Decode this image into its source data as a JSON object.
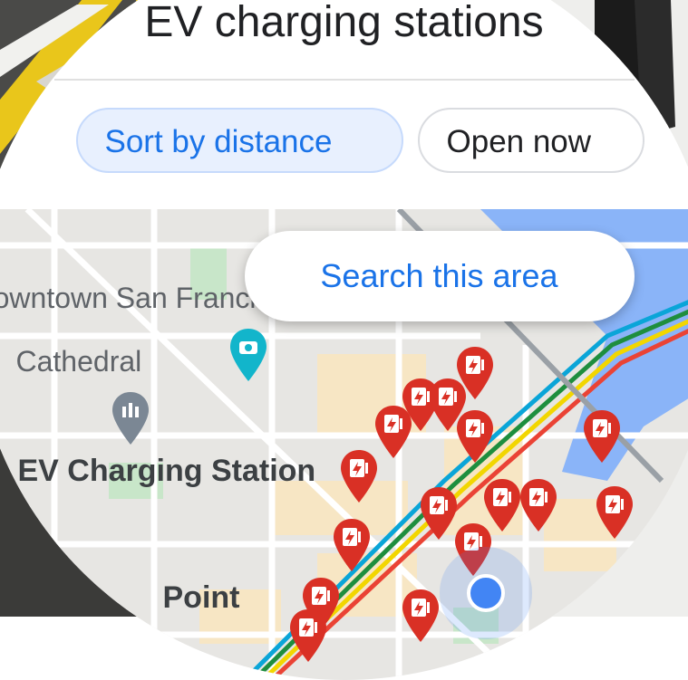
{
  "search": {
    "query": "EV charging stations"
  },
  "chips": [
    {
      "label": "Sort by distance",
      "selected": true
    },
    {
      "label": "Open now",
      "selected": false
    }
  ],
  "map": {
    "search_this_area": "Search this area",
    "labels": {
      "downtown": "Downtown San Francisco",
      "cathedral": "Cathedral",
      "ev_station": "EV Charging Station",
      "point": "Point"
    },
    "icons": [
      "ev-charger-pin",
      "camera-pin",
      "landmark-pin",
      "current-location-dot"
    ]
  },
  "colors": {
    "accent": "#1a73e8",
    "chip_selected_bg": "#e8f0fe",
    "pin_red": "#d93025",
    "water": "#8ab4f8",
    "transit_blue": "#0aa5d8",
    "transit_green": "#1e8e3e",
    "transit_yellow": "#f2d600",
    "transit_red": "#ea4335",
    "location_dot": "#4285f4"
  }
}
